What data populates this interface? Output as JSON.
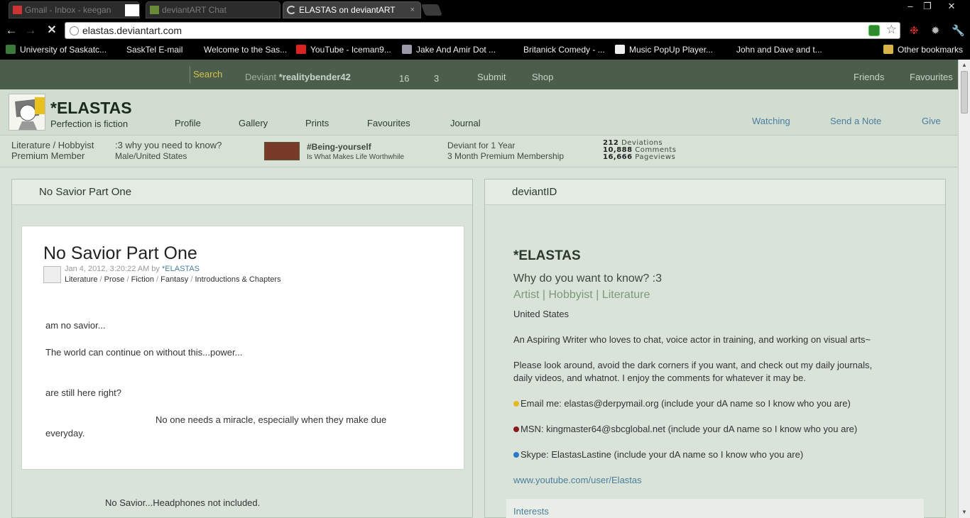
{
  "browser": {
    "tabs": [
      {
        "label": "Gmail - Inbox - keegan",
        "active": false
      },
      {
        "label": "deviantART Chat",
        "active": false
      },
      {
        "label": "ELASTAS on deviantART",
        "active": true
      }
    ],
    "close_tab": "×",
    "window_controls": {
      "minimize": "–",
      "restore": "❐",
      "close": "✕"
    },
    "url": "elastas.deviantart.com",
    "bookmarks": [
      "University of Saskatc...",
      "SaskTel E-mail",
      "Welcome to the Sas...",
      "YouTube - Iceman9...",
      "Jake And Amir Dot ...",
      "Britanick Comedy - ...",
      "Music PopUp Player...",
      "John and Dave and t..."
    ],
    "other_bookmarks": "Other bookmarks"
  },
  "topnav": {
    "search": "Search",
    "deviant_prefix": "Deviant",
    "deviant_name": "*realitybender42",
    "count1": "16",
    "count2": "3",
    "submit": "Submit",
    "shop": "Shop",
    "friends": "Friends",
    "favourites": "Favourites"
  },
  "profile": {
    "name": "*ELASTAS",
    "tagline": "Perfection is fiction",
    "tabs": [
      "Profile",
      "Gallery",
      "Prints",
      "Favourites",
      "Journal"
    ],
    "actions": {
      "watching": "Watching",
      "note": "Send a Note",
      "give": "Give"
    }
  },
  "infobar": {
    "category": "Literature / Hobbyist",
    "membership": "Premium Member",
    "why": ":3 why you need to know?",
    "location": "Male/United States",
    "badge_title": "#Being-yourself",
    "badge_sub": "Is What Makes Life Worthwhile",
    "deviant_for": "Deviant for 1 Year",
    "premium_for": "3 Month Premium Membership",
    "stats": [
      {
        "num": "212",
        "label": "Deviations"
      },
      {
        "num": "10,888",
        "label": "Comments"
      },
      {
        "num": "16,666",
        "label": "Pageviews"
      }
    ]
  },
  "left_panel": {
    "title": "No Savior Part One",
    "doc_title": "No Savior Part One",
    "date": "Jan 4, 2012, 3:20:22 AM by",
    "author": "*ELASTAS",
    "categories": [
      "Literature",
      "Prose",
      "Fiction",
      "Fantasy",
      "Introductions & Chapters"
    ],
    "cat_sep": " / ",
    "lines": [
      "am no savior...",
      "The world can continue on without this...power...",
      "are still here right?",
      "No one needs a miracle, especially when they make due",
      "everyday."
    ],
    "caption": "No Savior...Headphones not included."
  },
  "right_panel": {
    "title": "deviantID",
    "name": "*ELASTAS",
    "question": "Why do you want to know? :3",
    "type": "Artist | Hobbyist | Literature",
    "country": "United States",
    "bio1": "An Aspiring Writer who loves to chat, voice actor in training, and working on visual arts~",
    "bio2a": "Please look around, avoid the dark corners if you want, and check out my daily journals,",
    "bio2b": "daily videos, and whatnot. I enjoy the comments for whatever it may be.",
    "email": "Email me: elastas@derpymail.org (include your dA name so I know who you are)",
    "msn": "MSN: kingmaster64@sbcglobal.net (include your dA name so I know who you are)",
    "skype": "Skype: ElastasLastine (include your dA name so I know who you are)",
    "youtube": "www.youtube.com/user/Elastas",
    "interests": "Interests"
  },
  "colors": {
    "nav_bg": "#4b5e4c",
    "page_bg": "#dae3d9",
    "link": "#4a7e9a",
    "search_accent": "#d6c14a"
  }
}
